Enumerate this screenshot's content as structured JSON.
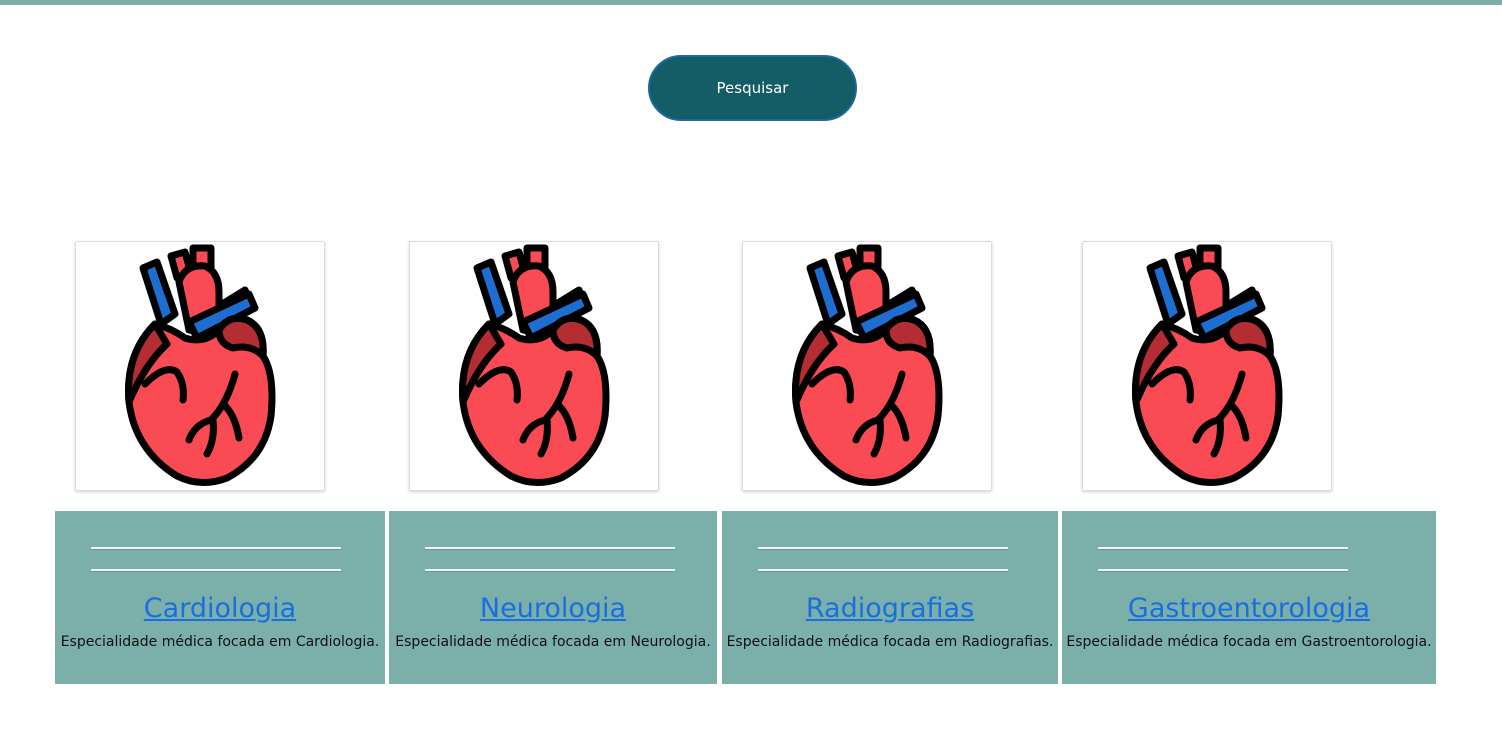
{
  "header": {
    "accent_color": "#7aafaa"
  },
  "search": {
    "button_label": "Pesquisar",
    "button_color": "#145d66"
  },
  "cards": [
    {
      "title": "Cardiologia",
      "description": "Especialidade médica focada em Cardiologia.",
      "icon": "heart-icon"
    },
    {
      "title": "Neurologia",
      "description": "Especialidade médica focada em Neurologia.",
      "icon": "heart-icon"
    },
    {
      "title": "Radiografias",
      "description": "Especialidade médica focada em Radiografias.",
      "icon": "heart-icon"
    },
    {
      "title": "Gastroentorologia",
      "description": "Especialidade médica focada em Gastroentorologia.",
      "icon": "heart-icon"
    }
  ],
  "colors": {
    "card_background": "#7aafaa",
    "link": "#1a6fe0",
    "heart_red": "#fa4b55",
    "heart_dark_red": "#b42d32",
    "heart_blue": "#1e6ed2"
  }
}
